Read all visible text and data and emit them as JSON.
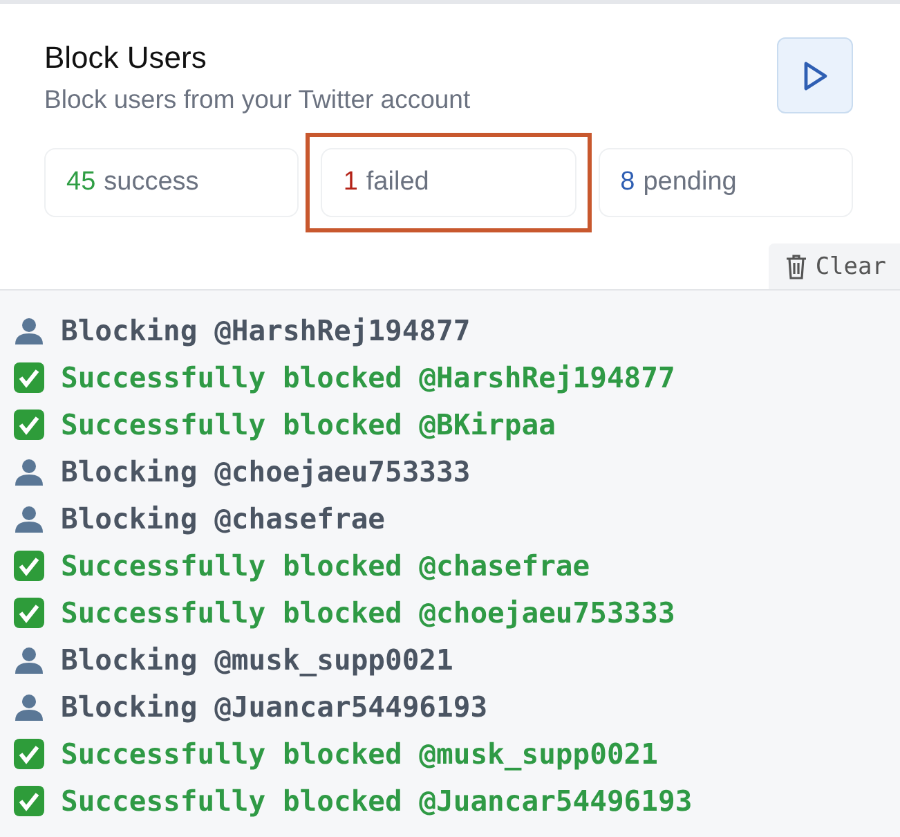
{
  "header": {
    "title": "Block Users",
    "subtitle": "Block users from your Twitter account"
  },
  "stats": [
    {
      "count": "45",
      "label": "success",
      "color": "#2f9e44",
      "highlighted": false
    },
    {
      "count": "1",
      "label": "failed",
      "color": "#b42318",
      "highlighted": true
    },
    {
      "count": "8",
      "label": "pending",
      "color": "#2f5fb3",
      "highlighted": false
    }
  ],
  "clear_button": "Clear",
  "log": [
    {
      "kind": "blocking",
      "text": "Blocking @HarshRej194877"
    },
    {
      "kind": "success",
      "text": "Successfully blocked @HarshRej194877"
    },
    {
      "kind": "success",
      "text": "Successfully blocked @BKirpaa"
    },
    {
      "kind": "blocking",
      "text": "Blocking @choejaeu753333"
    },
    {
      "kind": "blocking",
      "text": "Blocking @chasefrae"
    },
    {
      "kind": "success",
      "text": "Successfully blocked @chasefrae"
    },
    {
      "kind": "success",
      "text": "Successfully blocked @choejaeu753333"
    },
    {
      "kind": "blocking",
      "text": "Blocking @musk_supp0021"
    },
    {
      "kind": "blocking",
      "text": "Blocking @Juancar54496193"
    },
    {
      "kind": "success",
      "text": "Successfully blocked @musk_supp0021"
    },
    {
      "kind": "success",
      "text": "Successfully blocked @Juancar54496193"
    }
  ]
}
